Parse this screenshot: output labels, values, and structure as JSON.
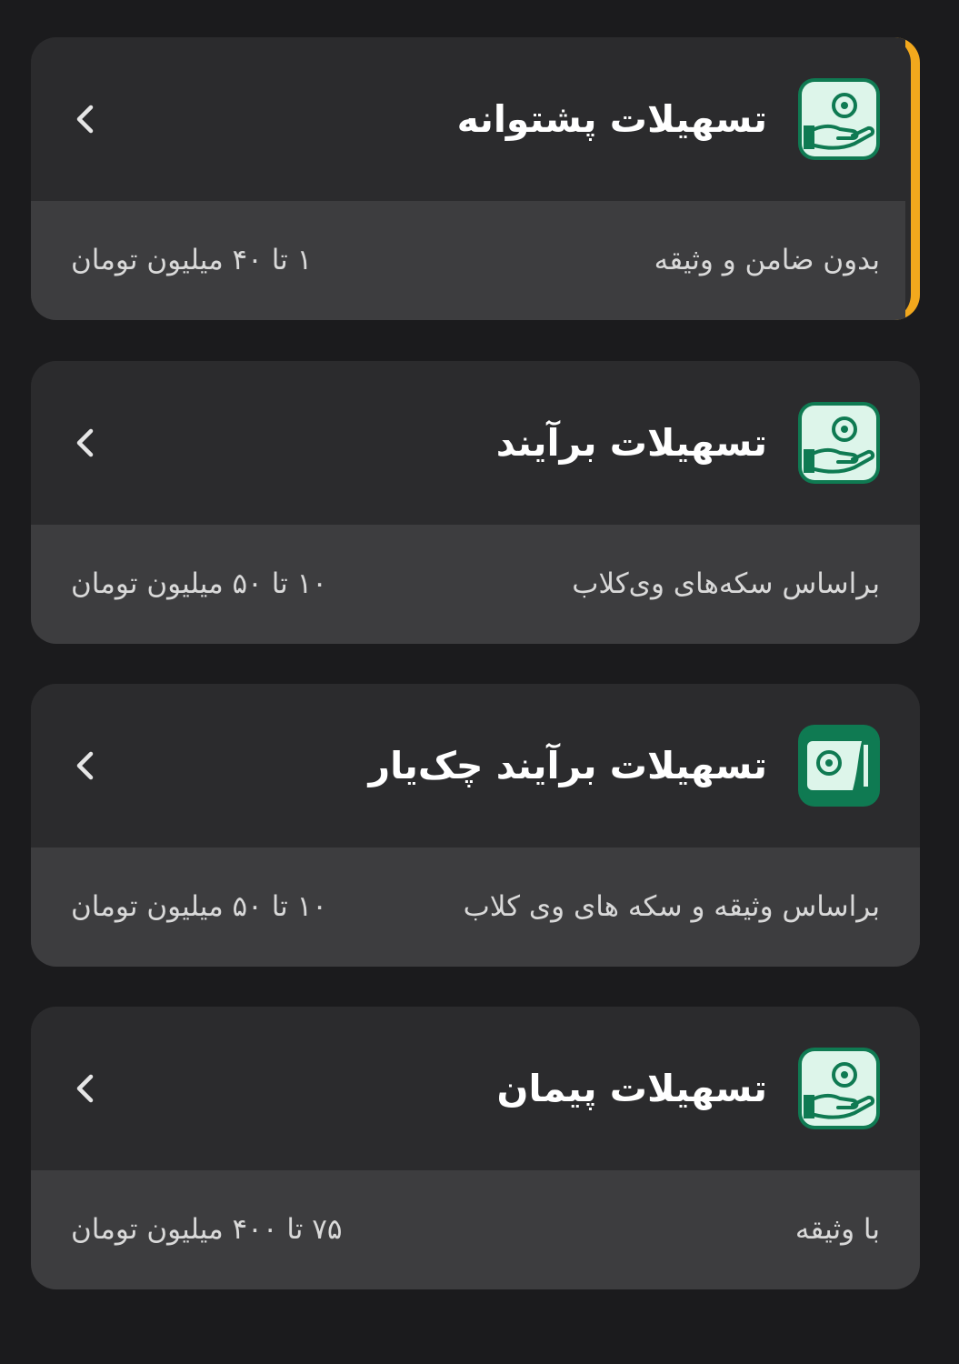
{
  "accent_color": "#f2a81d",
  "icon_color": "#0f7a52",
  "cards": [
    {
      "title": "تسهیلات پشتوانه",
      "description": "بدون ضامن و وثیقه",
      "range": "۱ تا ۴۰ میلیون تومان",
      "icon": "hand-coin-icon",
      "active": true
    },
    {
      "title": "تسهیلات برآیند",
      "description": "براساس سکه‌های وی‌کلاب",
      "range": "۱۰ تا ۵۰ میلیون تومان",
      "icon": "hand-coin-icon",
      "active": false
    },
    {
      "title": "تسهیلات برآیند چک‌یار",
      "description": "براساس وثیقه و سکه های وی کلاب",
      "range": "۱۰ تا ۵۰ میلیون تومان",
      "icon": "cheque-icon",
      "active": false
    },
    {
      "title": "تسهیلات پیمان",
      "description": "با وثیقه",
      "range": "۷۵ تا ۴۰۰ میلیون تومان",
      "icon": "hand-coin-icon",
      "active": false
    }
  ]
}
